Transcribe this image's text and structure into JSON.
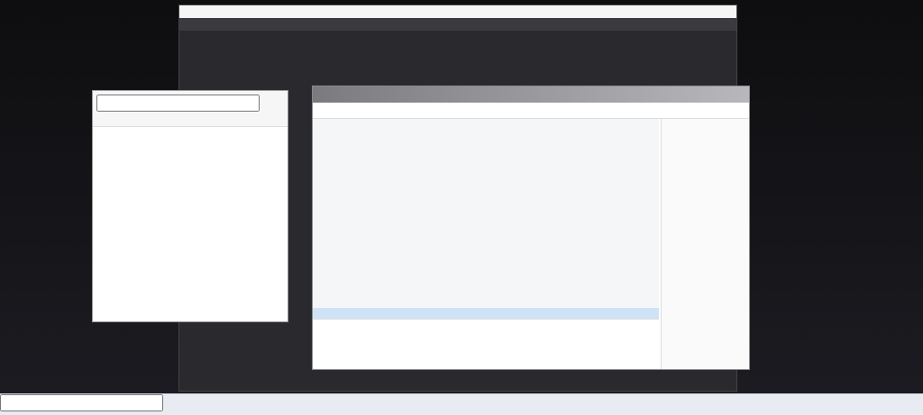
{
  "desktop_icons": [],
  "obs": {
    "title": "",
    "menu": []
  },
  "history": {
    "title": "",
    "search_placeholder": "",
    "rows": [],
    "footer_date": ""
  },
  "chat": {
    "title": "",
    "tabs": [],
    "messages": [],
    "notice": "",
    "input_text": "",
    "close_label": "",
    "send_label": "",
    "sidebar": {
      "announcement_title": "",
      "members_count": "",
      "members": []
    }
  },
  "taskbar": {
    "search_placeholder": "",
    "clock_time": "",
    "clock_date": ""
  }
}
